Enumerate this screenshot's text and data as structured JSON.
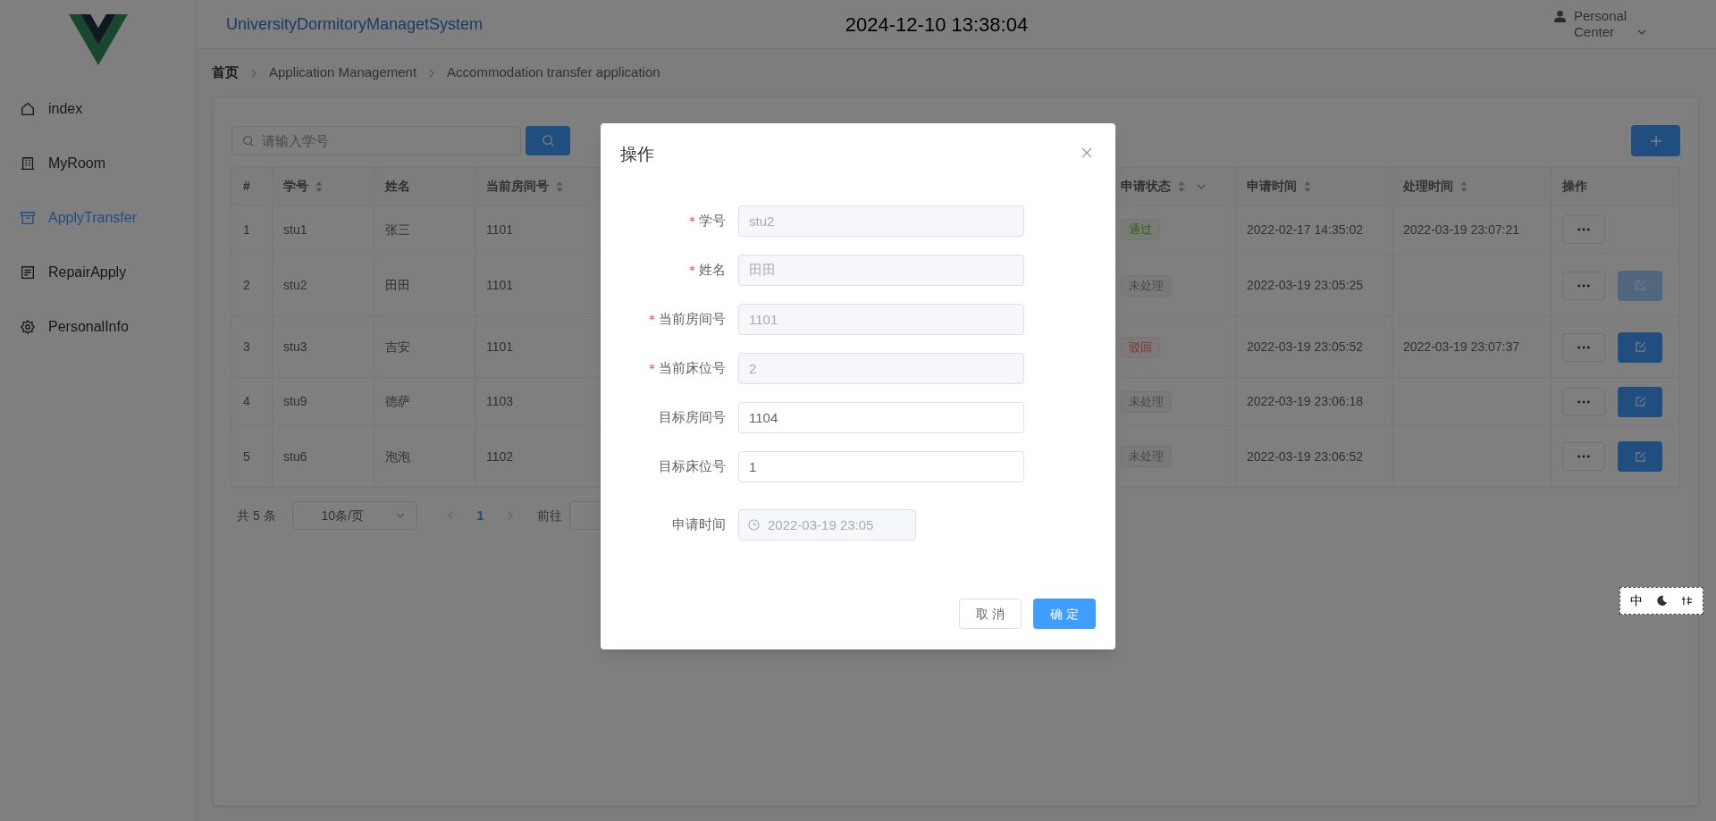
{
  "sidebar": {
    "items": [
      {
        "label": "index",
        "selected": false
      },
      {
        "label": "MyRoom",
        "selected": false
      },
      {
        "label": "ApplyTransfer",
        "selected": true
      },
      {
        "label": "RepairApply",
        "selected": false
      },
      {
        "label": "PersonalInfo",
        "selected": false
      }
    ]
  },
  "header": {
    "title": "UniversityDormitoryManagetSystem",
    "clock": "2024-12-10 13:38:04",
    "user_menu": "Personal Center"
  },
  "breadcrumb": [
    "首页",
    "Application Management",
    "Accommodation transfer application"
  ],
  "search": {
    "placeholder": "请输入学号"
  },
  "table": {
    "columns": [
      {
        "label": "#",
        "sortable": false,
        "filterable": false
      },
      {
        "label": "学号",
        "sortable": true,
        "filterable": false
      },
      {
        "label": "姓名",
        "sortable": false,
        "filterable": false
      },
      {
        "label": "当前房间号",
        "sortable": true,
        "filterable": false
      },
      {
        "label": "申请状态",
        "sortable": true,
        "filterable": true
      },
      {
        "label": "申请时间",
        "sortable": true,
        "filterable": false
      },
      {
        "label": "处理时间",
        "sortable": true,
        "filterable": false
      },
      {
        "label": "操作",
        "sortable": false,
        "filterable": false
      }
    ],
    "rows": [
      {
        "index": "1",
        "student_id": "stu1",
        "name": "张三",
        "room": "1101",
        "status": {
          "label": "通过",
          "kind": "success"
        },
        "applied": "2022-02-17 14:35:02",
        "processed": "2022-03-19 23:07:21",
        "has_edit": false
      },
      {
        "index": "2",
        "student_id": "stu2",
        "name": "田田",
        "room": "1101",
        "status": {
          "label": "未处理",
          "kind": "info"
        },
        "applied": "2022-03-19 23:05:25",
        "has_edit": true,
        "edit_disabled": true
      },
      {
        "index": "3",
        "student_id": "stu3",
        "name": "吉安",
        "room": "1101",
        "status": {
          "label": "驳回",
          "kind": "danger"
        },
        "applied": "2022-03-19 23:05:52",
        "processed": "2022-03-19 23:07:37",
        "has_edit": true,
        "edit_disabled": false
      },
      {
        "index": "4",
        "student_id": "stu9",
        "name": "德萨",
        "room": "1103",
        "status": {
          "label": "未处理",
          "kind": "info"
        },
        "applied": "2022-03-19 23:06:18",
        "has_edit": true,
        "edit_disabled": false
      },
      {
        "index": "5",
        "student_id": "stu6",
        "name": "泡泡",
        "room": "1102",
        "status": {
          "label": "未处理",
          "kind": "info"
        },
        "applied": "2022-03-19 23:06:52",
        "has_edit": true,
        "edit_disabled": false
      }
    ]
  },
  "pagination": {
    "total": "共 5 条",
    "page_size": "10条/页",
    "pages": [
      {
        "label": "1",
        "selected": true
      }
    ],
    "goto_label": "前往"
  },
  "dialog": {
    "title": "操作",
    "fields": [
      {
        "label": "学号",
        "required": true,
        "value": "stu2",
        "disabled": true,
        "kind": "text"
      },
      {
        "label": "姓名",
        "required": true,
        "value": "田田",
        "disabled": true,
        "kind": "text"
      },
      {
        "label": "当前房间号",
        "required": true,
        "value": "1101",
        "disabled": true,
        "kind": "text"
      },
      {
        "label": "当前床位号",
        "required": true,
        "value": "2",
        "disabled": true,
        "kind": "text"
      },
      {
        "label": "目标房间号",
        "required": false,
        "value": "1104",
        "disabled": false,
        "kind": "text"
      },
      {
        "label": "目标床位号",
        "required": false,
        "value": "1",
        "disabled": false,
        "kind": "text"
      },
      {
        "label": "申请时间",
        "required": false,
        "value": "2022-03-19 23:05",
        "disabled": true,
        "kind": "datetime"
      }
    ],
    "buttons": [
      {
        "label": "取 消",
        "primary": false
      },
      {
        "label": "确 定",
        "primary": true
      }
    ]
  },
  "ime_toolbar": {
    "mode": "中"
  }
}
